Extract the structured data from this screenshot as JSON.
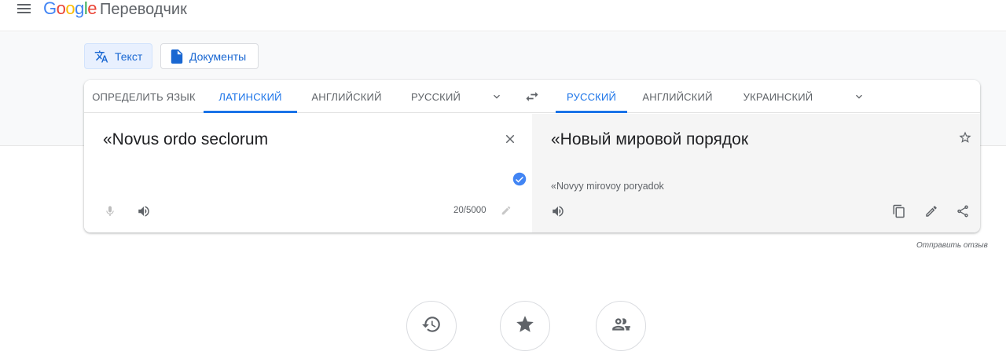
{
  "header": {
    "logo_word": "Google",
    "product": "Переводчик",
    "menu_icon": "hamburger-menu-icon"
  },
  "modes": {
    "text_label": "Текст",
    "docs_label": "Документы"
  },
  "source_langs": [
    {
      "label": "ОПРЕДЕЛИТЬ ЯЗЫК",
      "active": false
    },
    {
      "label": "ЛАТИНСКИЙ",
      "active": true
    },
    {
      "label": "АНГЛИЙСКИЙ",
      "active": false
    },
    {
      "label": "РУССКИЙ",
      "active": false
    }
  ],
  "target_langs": [
    {
      "label": "РУССКИЙ",
      "active": true
    },
    {
      "label": "АНГЛИЙСКИЙ",
      "active": false
    },
    {
      "label": "УКРАИНСКИЙ",
      "active": false
    }
  ],
  "source": {
    "text": "«Novus ordo seclorum",
    "char_count": "20/5000"
  },
  "target": {
    "text": "«Новый мировой порядок",
    "transliteration": "«Novyy mirovoy poryadok"
  },
  "feedback_label": "Отправить отзыв",
  "bottom_actions": [
    "history-icon",
    "saved-star-icon",
    "community-icon"
  ],
  "colors": {
    "accent": "#1a73e8",
    "icon_gray": "#5f6368",
    "target_bg": "#f5f5f5"
  }
}
